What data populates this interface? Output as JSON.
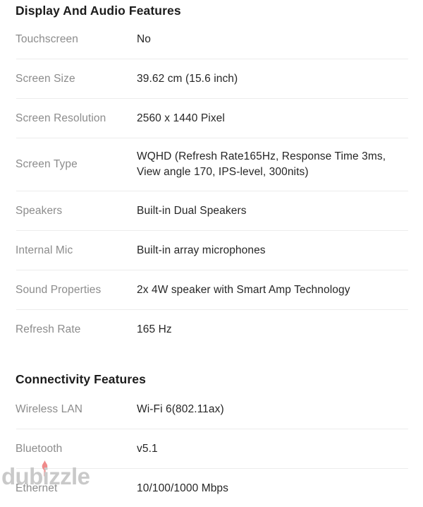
{
  "page": {
    "background_color": "#ffffff",
    "label_color": "#8c8c8c",
    "value_color": "#262626",
    "heading_color": "#1c1c1c",
    "divider_color": "#ececec"
  },
  "sections": [
    {
      "id": "display",
      "title": "Display And Audio Features",
      "rows": [
        {
          "label": "Touchscreen",
          "value": "No"
        },
        {
          "label": "Screen Size",
          "value": "39.62 cm (15.6 inch)"
        },
        {
          "label": "Screen Resolution",
          "value": "2560 x 1440 Pixel"
        },
        {
          "label": "Screen Type",
          "value": "WQHD (Refresh Rate165Hz, Response Time 3ms, View angle 170, IPS-level, 300nits)"
        },
        {
          "label": "Speakers",
          "value": "Built-in Dual Speakers"
        },
        {
          "label": "Internal Mic",
          "value": "Built-in array microphones"
        },
        {
          "label": "Sound Properties",
          "value": "2x 4W speaker with Smart Amp Technology"
        },
        {
          "label": "Refresh Rate",
          "value": "165 Hz"
        }
      ]
    },
    {
      "id": "connectivity",
      "title": "Connectivity Features",
      "rows": [
        {
          "label": "Wireless LAN",
          "value": "Wi-Fi 6(802.11ax)"
        },
        {
          "label": "Bluetooth",
          "value": "v5.1"
        },
        {
          "label": "Ethernet",
          "value": "10/100/1000 Mbps"
        }
      ]
    }
  ],
  "watermark": {
    "text": "dubizzle",
    "text_color": "#c9c9c9",
    "mark_color": "#ef8a8a"
  }
}
